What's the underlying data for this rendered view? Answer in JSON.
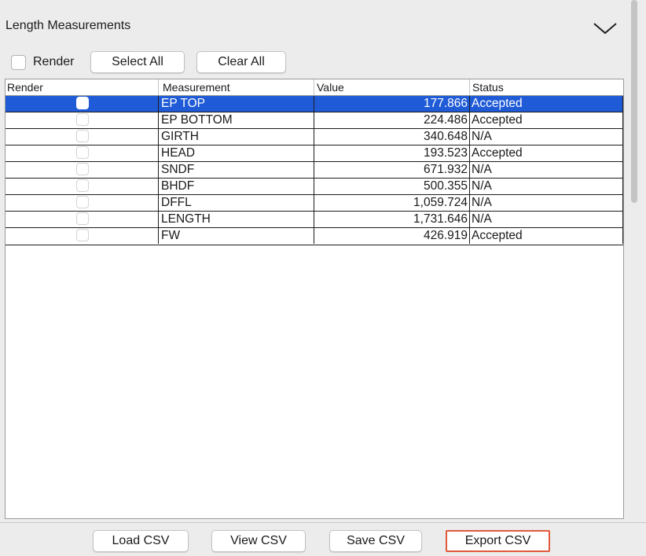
{
  "panel": {
    "title": "Length Measurements"
  },
  "toolbar": {
    "render_label": "Render",
    "select_all": "Select All",
    "clear_all": "Clear All"
  },
  "table": {
    "columns": [
      "Render",
      "Measurement",
      "Value",
      "Status"
    ],
    "rows": [
      {
        "measurement": "EP TOP",
        "value": "177.866",
        "status": "Accepted",
        "selected": true
      },
      {
        "measurement": "EP BOTTOM",
        "value": "224.486",
        "status": "Accepted",
        "selected": false
      },
      {
        "measurement": "GIRTH",
        "value": "340.648",
        "status": "N/A",
        "selected": false
      },
      {
        "measurement": "HEAD",
        "value": "193.523",
        "status": "Accepted",
        "selected": false
      },
      {
        "measurement": "SNDF",
        "value": "671.932",
        "status": "N/A",
        "selected": false
      },
      {
        "measurement": "BHDF",
        "value": "500.355",
        "status": "N/A",
        "selected": false
      },
      {
        "measurement": "DFFL",
        "value": "1,059.724",
        "status": "N/A",
        "selected": false
      },
      {
        "measurement": "LENGTH",
        "value": "1,731.646",
        "status": "N/A",
        "selected": false
      },
      {
        "measurement": "FW",
        "value": "426.919",
        "status": "Accepted",
        "selected": false
      }
    ]
  },
  "footer": {
    "load_csv": "Load CSV",
    "view_csv": "View CSV",
    "save_csv": "Save CSV",
    "export_csv": "Export CSV"
  },
  "colors": {
    "selection": "#1f5bd6",
    "highlight_border": "#e05a3a"
  },
  "icons": {
    "collapse": "chevron-down-icon"
  }
}
